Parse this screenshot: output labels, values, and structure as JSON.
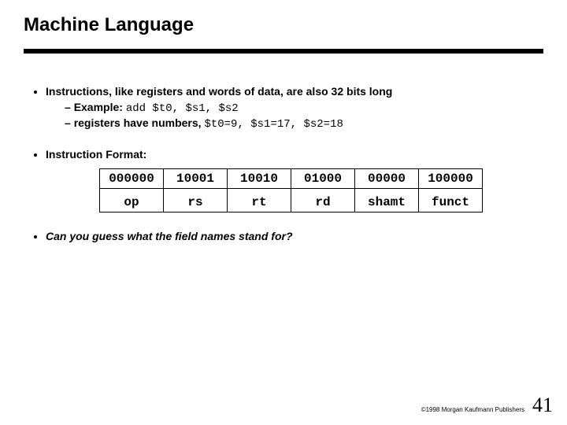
{
  "title": "Machine Language",
  "bullets": {
    "b1": {
      "lead": "Instructions, like registers and words of data, are also 32 bits long",
      "sub1_prefix": "Example:  ",
      "sub1_code": "add $t0, $s1, $s2",
      "sub2_prefix": "registers have numbers, ",
      "sub2_code": "$t0=9, $s1=17, $s2=18"
    },
    "b2": {
      "lead": "Instruction Format:"
    },
    "b3": {
      "lead": "Can you guess what the field names stand for?"
    }
  },
  "table": {
    "row1": {
      "c0": "000000",
      "c1": "10001",
      "c2": "10010",
      "c3": "01000",
      "c4": "00000",
      "c5": "100000"
    },
    "row2": {
      "c0": "op",
      "c1": "rs",
      "c2": "rt",
      "c3": "rd",
      "c4": "shamt",
      "c5": "funct"
    }
  },
  "footer": {
    "copyright": "©1998 Morgan Kaufmann Publishers",
    "page": "41"
  }
}
